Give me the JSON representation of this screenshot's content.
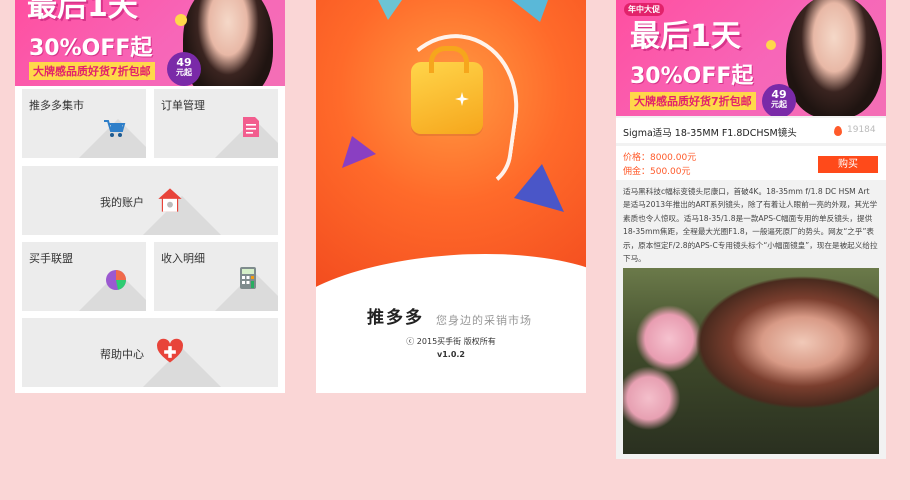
{
  "banner": {
    "headline1": "最后1天",
    "headline2": "30%OFF起",
    "strip": "大牌感品质好货7折包邮",
    "badge_price": "49",
    "badge_unit": "元起",
    "event_tag": "年中大促"
  },
  "phone1": {
    "tiles": [
      {
        "label": "推多多集市",
        "icon": "shopping-cart-icon"
      },
      {
        "label": "订单管理",
        "icon": "document-icon"
      },
      {
        "label": "我的账户",
        "icon": "home-icon"
      },
      {
        "label": "买手联盟",
        "icon": "pie-chart-icon"
      },
      {
        "label": "收入明细",
        "icon": "calculator-icon"
      },
      {
        "label": "帮助中心",
        "icon": "heart-plus-icon"
      }
    ]
  },
  "phone2": {
    "app_name": "推多多",
    "slogan": "您身边的采销市场",
    "copyright": "ⓒ 2015买手街  版权所有",
    "version": "v1.0.2"
  },
  "phone3": {
    "product_title": "Sigma适马 18-35MM F1.8DCHSM镜头",
    "view_count": "19184",
    "price_label": "价格：8000.00元",
    "commission_label": "佣金：500.00元",
    "buy_label": "购买",
    "description": "适马黑科技c幅标变镜头尼康口，首破4K。18-35mm f/1.8 DC HSM Art 是适马2013年推出的ART系列镜头，除了有着让人眼前一亮的外观，其光学素质也令人惊叹。适马18-35/1.8是一款APS-C幅面专用的单反镜头，提供18-35mm焦距，全程最大光圈F1.8，一般逼死原厂的势头。网友“之乎”表示，原本恒定F/2.8的APS-C专用镜头标个“小幅面镜皇”，现在是被起义给拉下马。"
  },
  "colors": {
    "background": "#fad6d6",
    "accent": "#ff4a1a",
    "banner_pink": "#ff4fa0",
    "splash_orange": "#ff6a2a"
  }
}
